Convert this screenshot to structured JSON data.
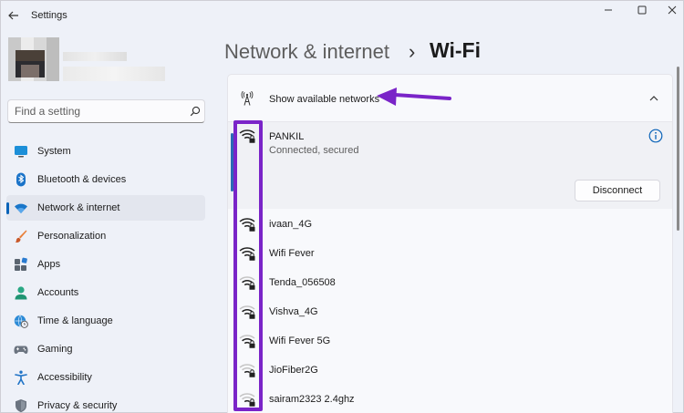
{
  "window": {
    "title": "Settings",
    "controls": {
      "minimize": "minimize-icon",
      "maximize": "maximize-icon",
      "close": "close-icon"
    }
  },
  "search": {
    "placeholder": "Find a setting",
    "icon": "search-icon"
  },
  "sidebar": {
    "items": [
      {
        "label": "System",
        "icon": "monitor-icon"
      },
      {
        "label": "Bluetooth & devices",
        "icon": "bluetooth-icon"
      },
      {
        "label": "Network & internet",
        "icon": "wifi-icon",
        "active": true
      },
      {
        "label": "Personalization",
        "icon": "brush-icon"
      },
      {
        "label": "Apps",
        "icon": "apps-icon"
      },
      {
        "label": "Accounts",
        "icon": "person-icon"
      },
      {
        "label": "Time & language",
        "icon": "globe-clock-icon"
      },
      {
        "label": "Gaming",
        "icon": "gamepad-icon"
      },
      {
        "label": "Accessibility",
        "icon": "accessibility-icon"
      },
      {
        "label": "Privacy & security",
        "icon": "shield-icon"
      }
    ]
  },
  "header": {
    "parent": "Network & internet",
    "separator": "›",
    "current": "Wi-Fi"
  },
  "wifi": {
    "show_networks_label": "Show available networks",
    "connected": {
      "name": "PANKIL",
      "status": "Connected, secured",
      "action": "Disconnect"
    },
    "networks": [
      {
        "name": "ivaan_4G",
        "signal": 4
      },
      {
        "name": "Wifi Fever",
        "signal": 4
      },
      {
        "name": "Tenda_056508",
        "signal": 3
      },
      {
        "name": "Vishva_4G",
        "signal": 3
      },
      {
        "name": "Wifi Fever 5G",
        "signal": 3
      },
      {
        "name": "JioFiber2G",
        "signal": 2
      },
      {
        "name": "sairam2323 2.4ghz",
        "signal": 2
      }
    ]
  },
  "colors": {
    "accent": "#0a63b8",
    "annotation": "#7a24c8",
    "background": "#eef1f8"
  }
}
